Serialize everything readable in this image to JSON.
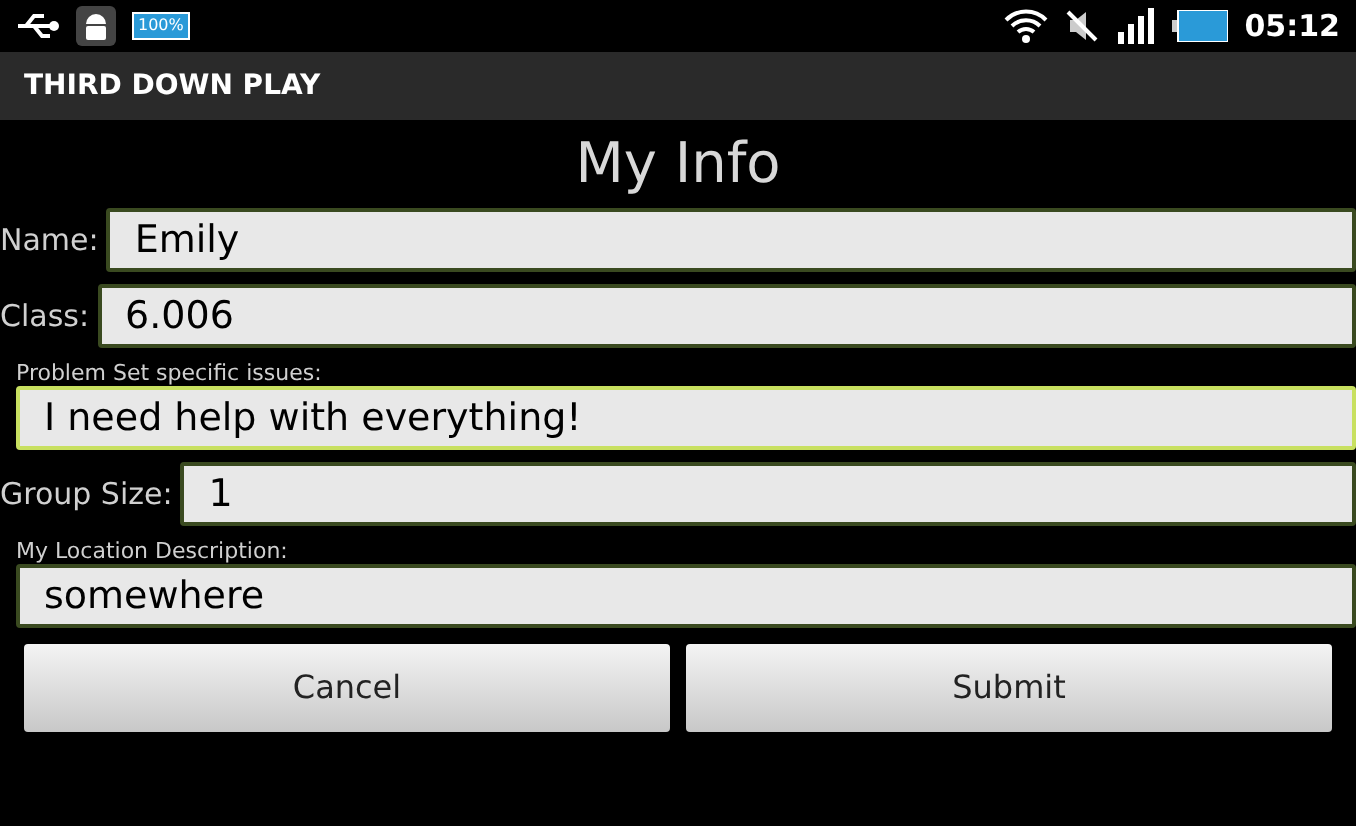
{
  "status_bar": {
    "battery_notice": "100%",
    "time": "05:12"
  },
  "app_bar": {
    "title": "THIRD DOWN PLAY"
  },
  "heading": "My Info",
  "fields": [
    {
      "kind": "inline",
      "label": "Name:",
      "value": "Emily",
      "focused": false
    },
    {
      "kind": "inline",
      "label": "Class:",
      "value": "6.006",
      "focused": false
    },
    {
      "kind": "stacked",
      "label": "Problem Set specific issues:",
      "value": "I need help with everything!",
      "focused": true
    },
    {
      "kind": "inline",
      "label": "Group Size:",
      "value": "1",
      "focused": false
    },
    {
      "kind": "stacked",
      "label": "My Location Description:",
      "value": "somewhere",
      "focused": false
    }
  ],
  "buttons": [
    "Cancel",
    "Submit"
  ]
}
